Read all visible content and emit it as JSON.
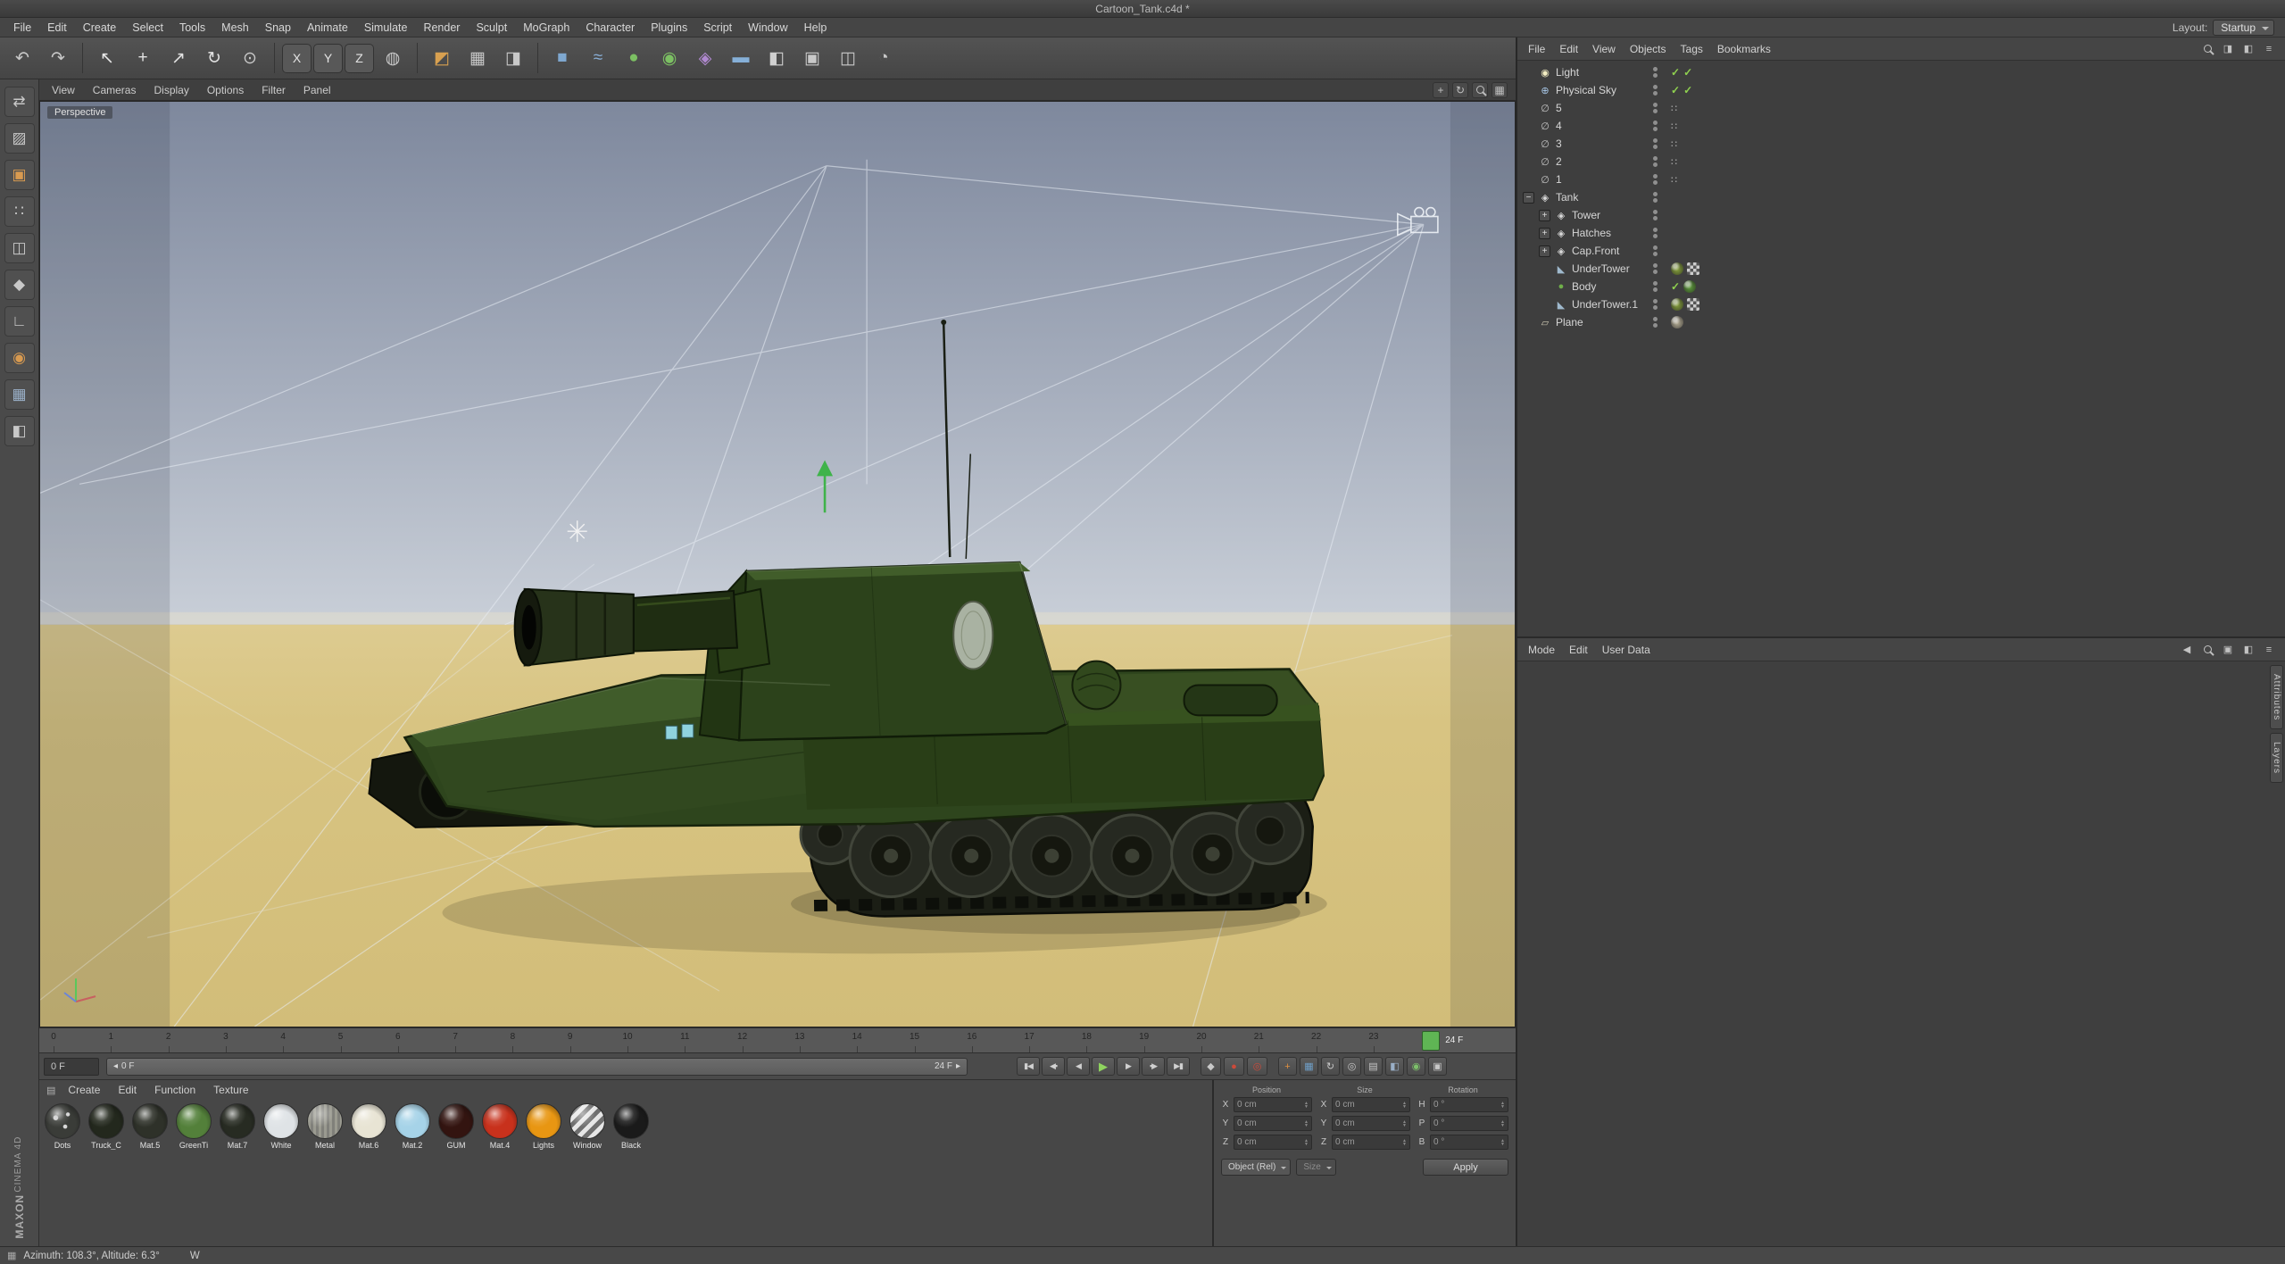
{
  "window": {
    "title": "Cartoon_Tank.c4d *"
  },
  "menubar": {
    "items": [
      "File",
      "Edit",
      "Create",
      "Select",
      "Tools",
      "Mesh",
      "Snap",
      "Animate",
      "Simulate",
      "Render",
      "Sculpt",
      "MoGraph",
      "Character",
      "Plugins",
      "Script",
      "Window",
      "Help"
    ],
    "layout_label": "Layout:",
    "layout_value": "Startup"
  },
  "toolbar": {
    "items": [
      {
        "name": "undo-button",
        "glyph": "↶"
      },
      {
        "name": "redo-button",
        "glyph": "↷"
      },
      {
        "sep": true
      },
      {
        "name": "live-selection-tool",
        "glyph": "↖",
        "color": "#e8e8e8"
      },
      {
        "name": "move-tool",
        "glyph": "+",
        "color": "#e2e2e2"
      },
      {
        "name": "scale-tool",
        "glyph": "↗",
        "color": "#e2e2e2"
      },
      {
        "name": "rotate-tool",
        "glyph": "↻",
        "color": "#e2e2e2"
      },
      {
        "name": "last-used-tool",
        "glyph": "⊙"
      },
      {
        "sep": true
      },
      {
        "name": "lock-x-axis-button",
        "glyph": "X",
        "axis": true
      },
      {
        "name": "lock-y-axis-button",
        "glyph": "Y",
        "axis": true
      },
      {
        "name": "lock-z-axis-button",
        "glyph": "Z",
        "axis": true
      },
      {
        "name": "coordinate-system-button",
        "glyph": "◍"
      },
      {
        "sep": true
      },
      {
        "name": "make-editable-button",
        "glyph": "◩",
        "color": "#d8a050"
      },
      {
        "name": "model-mode-button",
        "glyph": "▦",
        "color": "#c8c8c8"
      },
      {
        "name": "axis-mode-button",
        "glyph": "◨",
        "color": "#c8c8c8"
      },
      {
        "sep": true
      },
      {
        "name": "add-primitive-button",
        "glyph": "■",
        "color": "#7fa8d0"
      },
      {
        "name": "add-spline-button",
        "glyph": "≈",
        "color": "#8ab0d8"
      },
      {
        "name": "add-subdivision-surface-button",
        "glyph": "●",
        "color": "#7cc063"
      },
      {
        "name": "add-generator-button",
        "glyph": "◉",
        "color": "#7cc063"
      },
      {
        "name": "add-deformer-button",
        "glyph": "◈",
        "color": "#b089d0"
      },
      {
        "name": "add-environment-button",
        "glyph": "▬",
        "color": "#86b0d8"
      },
      {
        "name": "add-camera-button",
        "glyph": "◧",
        "color": "#d0d0d0"
      },
      {
        "name": "render-view-button",
        "glyph": "▣",
        "color": "#c8c8c8"
      },
      {
        "name": "render-to-picture-viewer-button",
        "glyph": "◫",
        "color": "#c8c8c8"
      },
      {
        "name": "render-settings-button",
        "glyph": "◔",
        "color": "#c8c8c8"
      }
    ]
  },
  "sidebar": {
    "items": [
      {
        "name": "make-editable-mode",
        "glyph": "⇄",
        "color": "#c8c8c8"
      },
      {
        "name": "texture-mode",
        "glyph": "▨",
        "color": "#c8c8c8"
      },
      {
        "name": "model-mode",
        "glyph": "▣",
        "color": "#d89a50"
      },
      {
        "name": "point-mode",
        "glyph": "∷",
        "color": "#c8c8c8"
      },
      {
        "name": "edge-mode",
        "glyph": "◫",
        "color": "#c8c8c8"
      },
      {
        "name": "polygon-mode",
        "glyph": "◆",
        "color": "#c8c8c8"
      },
      {
        "name": "workplane-mode",
        "glyph": "∟",
        "color": "#c8c8c8"
      },
      {
        "name": "snap-toggle",
        "glyph": "◉",
        "color": "#d89a50"
      },
      {
        "name": "grid-snap-toggle",
        "glyph": "▦",
        "color": "#9ab0c8"
      },
      {
        "name": "lock-workplane-toggle",
        "glyph": "◧",
        "color": "#c8c8c8"
      }
    ]
  },
  "viewport": {
    "label": "Perspective",
    "menu": [
      "View",
      "Cameras",
      "Display",
      "Options",
      "Filter",
      "Panel"
    ],
    "corner_icons": [
      {
        "name": "pan-view-icon",
        "glyph": "+"
      },
      {
        "name": "orbit-view-icon",
        "glyph": "↻"
      },
      {
        "name": "zoom-view-icon",
        "glyph": "mag"
      },
      {
        "name": "toggle-views-icon",
        "glyph": "▦"
      }
    ]
  },
  "object_manager": {
    "menu": [
      "File",
      "Edit",
      "View",
      "Objects",
      "Tags",
      "Bookmarks"
    ],
    "icons": [
      {
        "name": "search-icon",
        "glyph": "mag"
      },
      {
        "name": "filter-icon",
        "glyph": "◨"
      },
      {
        "name": "lock-icon",
        "glyph": "◧"
      },
      {
        "name": "panel-menu-icon",
        "glyph": "≡"
      }
    ],
    "objects": [
      {
        "label": "Light",
        "icon": "light",
        "level": 0,
        "expander": "none",
        "tags": [
          {
            "type": "check"
          },
          {
            "type": "check"
          }
        ]
      },
      {
        "label": "Physical Sky",
        "icon": "sky",
        "level": 0,
        "expander": "none",
        "tags": [
          {
            "type": "check"
          },
          {
            "type": "check"
          }
        ]
      },
      {
        "label": "5",
        "icon": "null",
        "level": 0,
        "expander": "none",
        "tags": [
          {
            "type": "xpresso"
          }
        ]
      },
      {
        "label": "4",
        "icon": "null",
        "level": 0,
        "expander": "none",
        "tags": [
          {
            "type": "xpresso"
          }
        ]
      },
      {
        "label": "3",
        "icon": "null",
        "level": 0,
        "expander": "none",
        "tags": [
          {
            "type": "xpresso"
          }
        ]
      },
      {
        "label": "2",
        "icon": "null",
        "level": 0,
        "expander": "none",
        "tags": [
          {
            "type": "xpresso"
          }
        ]
      },
      {
        "label": "1",
        "icon": "null",
        "level": 0,
        "expander": "none",
        "tags": [
          {
            "type": "xpresso"
          }
        ]
      },
      {
        "label": "Tank",
        "icon": "hier",
        "level": 0,
        "expander": "minus",
        "tags": []
      },
      {
        "label": "Tower",
        "icon": "hier",
        "level": 1,
        "expander": "plus",
        "tags": []
      },
      {
        "label": "Hatches",
        "icon": "hier",
        "level": 1,
        "expander": "plus",
        "tags": []
      },
      {
        "label": "Cap.Front",
        "icon": "hier",
        "level": 1,
        "expander": "plus",
        "tags": []
      },
      {
        "label": "UnderTower",
        "icon": "poly",
        "level": 1,
        "expander": "none",
        "tags": [
          {
            "type": "material",
            "color": "#86a03c"
          },
          {
            "type": "texture"
          }
        ]
      },
      {
        "label": "Body",
        "icon": "sphere",
        "level": 1,
        "expander": "none",
        "tags": [
          {
            "type": "check"
          },
          {
            "type": "material",
            "color": "#5f9c3c"
          }
        ]
      },
      {
        "label": "UnderTower.1",
        "icon": "poly",
        "level": 1,
        "expander": "none",
        "tags": [
          {
            "type": "material",
            "color": "#86a03c"
          },
          {
            "type": "texture"
          }
        ]
      },
      {
        "label": "Plane",
        "icon": "plane",
        "level": 0,
        "expander": "none",
        "tags": [
          {
            "type": "material",
            "color": "#b5ad96"
          }
        ]
      }
    ]
  },
  "attribute_manager": {
    "menu": [
      "Mode",
      "Edit",
      "User Data"
    ],
    "icons": [
      {
        "name": "history-back-icon",
        "glyph": "◀"
      },
      {
        "name": "search-icon",
        "glyph": "mag"
      },
      {
        "name": "copy-icon",
        "glyph": "▣"
      },
      {
        "name": "lock-icon",
        "glyph": "◧"
      },
      {
        "name": "panel-menu-icon",
        "glyph": "≡"
      }
    ],
    "side_tabs": [
      "Attributes",
      "Layers"
    ]
  },
  "timeline": {
    "tick_start": 0,
    "tick_end": 23,
    "marker_label": "24 F",
    "current": "0 F",
    "range_start": "0 F",
    "range_end": "24 F",
    "range_left_icon": "◂",
    "range_right_icon": "▸",
    "transport": [
      {
        "name": "goto-start-button",
        "glyph": "▮◀"
      },
      {
        "name": "previous-key-button",
        "glyph": "◀▪"
      },
      {
        "name": "previous-frame-button",
        "glyph": "◀"
      },
      {
        "name": "play-button",
        "glyph": "▶",
        "accent": true,
        "color": "#8fd45f"
      },
      {
        "name": "next-frame-button",
        "glyph": "▶"
      },
      {
        "name": "next-key-button",
        "glyph": "▪▶"
      },
      {
        "name": "goto-end-button",
        "glyph": "▶▮"
      }
    ],
    "record_buttons": [
      {
        "name": "record-keyframe-button",
        "glyph": "◆",
        "color": "#c8c8c8"
      },
      {
        "name": "autokeying-button",
        "glyph": "●",
        "color": "#cc4a3a"
      },
      {
        "name": "keyframe-selection-button",
        "glyph": "◎",
        "color": "#cc4a3a"
      }
    ],
    "toggle_buttons": [
      {
        "name": "record-position-toggle",
        "glyph": "+",
        "color": "#e09040"
      },
      {
        "name": "record-scale-toggle",
        "glyph": "▦",
        "color": "#6f9fc8"
      },
      {
        "name": "record-rotation-toggle",
        "glyph": "↻",
        "color": "#c8c8c8"
      },
      {
        "name": "record-parameter-toggle",
        "glyph": "◎",
        "color": "#c8c8c8"
      },
      {
        "name": "record-pla-toggle",
        "glyph": "▤",
        "color": "#c8c8c8"
      },
      {
        "name": "playback-mode-toggle",
        "glyph": "◧",
        "color": "#9ab0c8"
      },
      {
        "name": "keying-settings-toggle",
        "glyph": "◉",
        "color": "#7dc06a"
      },
      {
        "name": "solo-animation-toggle",
        "glyph": "▣",
        "color": "#c8c8c8"
      }
    ]
  },
  "materials": {
    "menu": [
      "Create",
      "Edit",
      "Function",
      "Texture"
    ],
    "panel_icon": "▤",
    "items": [
      {
        "label": "Dots",
        "color": "#3a3c38",
        "variant": "dots"
      },
      {
        "label": "Truck_C",
        "color": "#23281d"
      },
      {
        "label": "Mat.5",
        "color": "#2e3129"
      },
      {
        "label": "GreenTi",
        "color": "#53803a"
      },
      {
        "label": "Mat.7",
        "color": "#272b22"
      },
      {
        "label": "White",
        "color": "#dfe3e6"
      },
      {
        "label": "Metal",
        "color": "#8f8f85",
        "variant": "texture"
      },
      {
        "label": "Mat.6",
        "color": "#e8e4d4"
      },
      {
        "label": "Mat.2",
        "color": "#a6d3e8"
      },
      {
        "label": "GUM",
        "color": "#331410"
      },
      {
        "label": "Mat.4",
        "color": "#c8311c"
      },
      {
        "label": "Lights",
        "color": "#e89612"
      },
      {
        "label": "Window",
        "color": "#bdbdbd",
        "variant": "stripes"
      },
      {
        "label": "Black",
        "color": "#1a1a1a"
      }
    ]
  },
  "coordinates": {
    "columns": [
      {
        "header": "Position",
        "rows": [
          {
            "axis": "X",
            "value": "0 cm"
          },
          {
            "axis": "Y",
            "value": "0 cm"
          },
          {
            "axis": "Z",
            "value": "0 cm"
          }
        ]
      },
      {
        "header": "Size",
        "rows": [
          {
            "axis": "X",
            "value": "0 cm"
          },
          {
            "axis": "Y",
            "value": "0 cm"
          },
          {
            "axis": "Z",
            "value": "0 cm"
          }
        ]
      },
      {
        "header": "Rotation",
        "rows": [
          {
            "axis": "H",
            "value": "0 °"
          },
          {
            "axis": "P",
            "value": "0 °"
          },
          {
            "axis": "B",
            "value": "0 °"
          }
        ]
      }
    ],
    "mode": "Object (Rel)",
    "size_mode": "Size",
    "apply": "Apply"
  },
  "statusbar": {
    "icon": "▦",
    "text": "Azimuth: 108.3°, Altitude: 6.3°",
    "suffix": "W"
  },
  "branding": {
    "line1": "MAXON",
    "line2": "CINEMA 4D"
  }
}
